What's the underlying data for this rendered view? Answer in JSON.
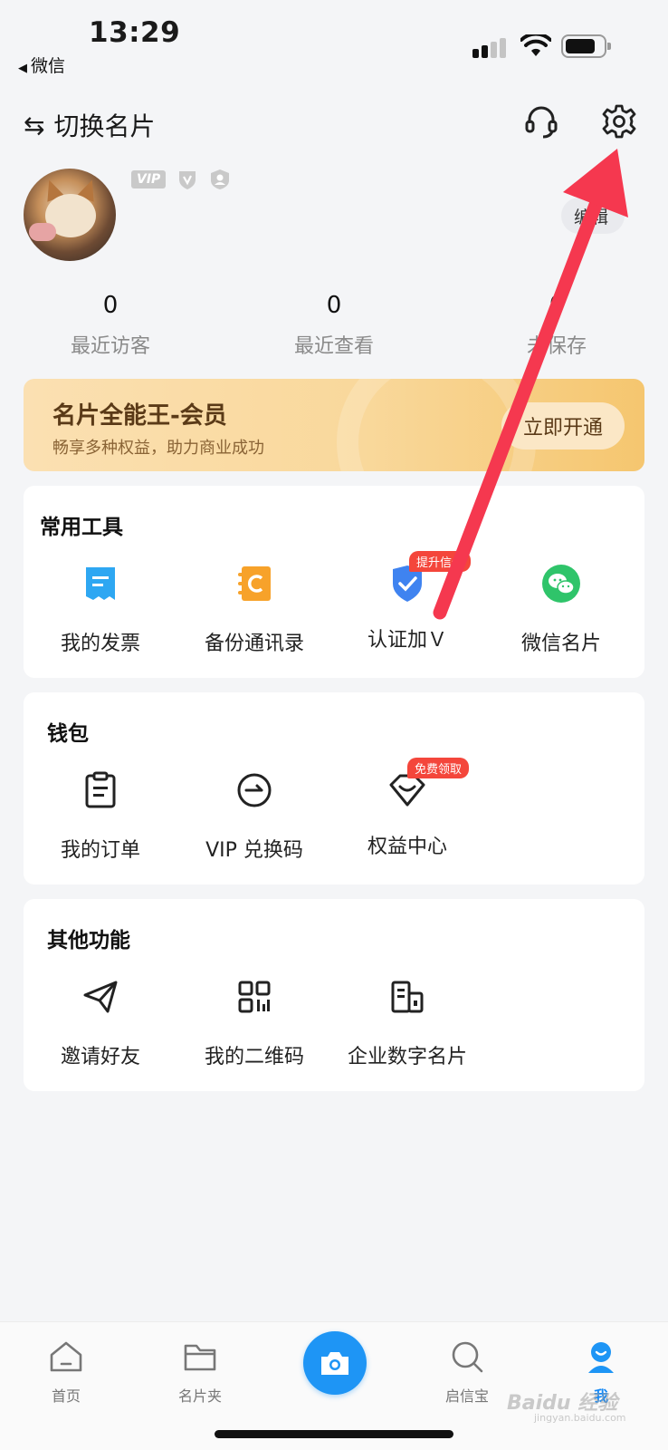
{
  "status_bar": {
    "time": "13:29",
    "back_app": "微信",
    "back_glyph": "◀"
  },
  "header": {
    "switch_label": "切换名片",
    "switch_glyph": "⇆",
    "service_icon": "headset-icon",
    "settings_icon": "gear-icon"
  },
  "profile": {
    "badges": [
      "VIP"
    ],
    "edit_label": "编辑"
  },
  "stats": [
    {
      "value": "0",
      "label": "最近访客"
    },
    {
      "value": "0",
      "label": "最近查看"
    },
    {
      "value": "0",
      "label": "未保存"
    }
  ],
  "vip_banner": {
    "title": "名片全能王-会员",
    "subtitle": "畅享多种权益，助力商业成功",
    "button": "立即开通"
  },
  "tools": {
    "title": "常用工具",
    "items": [
      {
        "label": "我的发票",
        "icon": "invoice-icon"
      },
      {
        "label": "备份通讯录",
        "icon": "contacts-backup-icon"
      },
      {
        "label": "认证加Ｖ",
        "icon": "verify-shield-icon",
        "tag": "提升信任"
      },
      {
        "label": "微信名片",
        "icon": "wechat-icon"
      }
    ]
  },
  "wallet": {
    "title": "钱包",
    "items": [
      {
        "label": "我的订单",
        "icon": "order-icon"
      },
      {
        "label": "VIP 兑换码",
        "icon": "redeem-icon"
      },
      {
        "label": "权益中心",
        "icon": "benefits-icon",
        "tag": "免费领取"
      }
    ]
  },
  "other": {
    "title": "其他功能",
    "items": [
      {
        "label": "邀请好友",
        "icon": "paper-plane-icon"
      },
      {
        "label": "我的二维码",
        "icon": "qr-code-icon"
      },
      {
        "label": "企业数字名片",
        "icon": "building-icon"
      }
    ]
  },
  "tabbar": {
    "items": [
      {
        "label": "首页",
        "icon": "home-icon"
      },
      {
        "label": "名片夹",
        "icon": "folder-icon"
      },
      {
        "label": "",
        "icon": "camera-icon"
      },
      {
        "label": "启信宝",
        "icon": "search-icon"
      },
      {
        "label": "我",
        "icon": "user-icon"
      }
    ],
    "active_index": 4
  },
  "watermark": {
    "text": "Baidu 经验",
    "sub": "jingyan.baidu.com"
  },
  "colors": {
    "accent": "#1e95f5",
    "annotation_arrow": "#f5384f",
    "tag_red": "#f4463b",
    "vip_gold": "#f9d89b"
  }
}
